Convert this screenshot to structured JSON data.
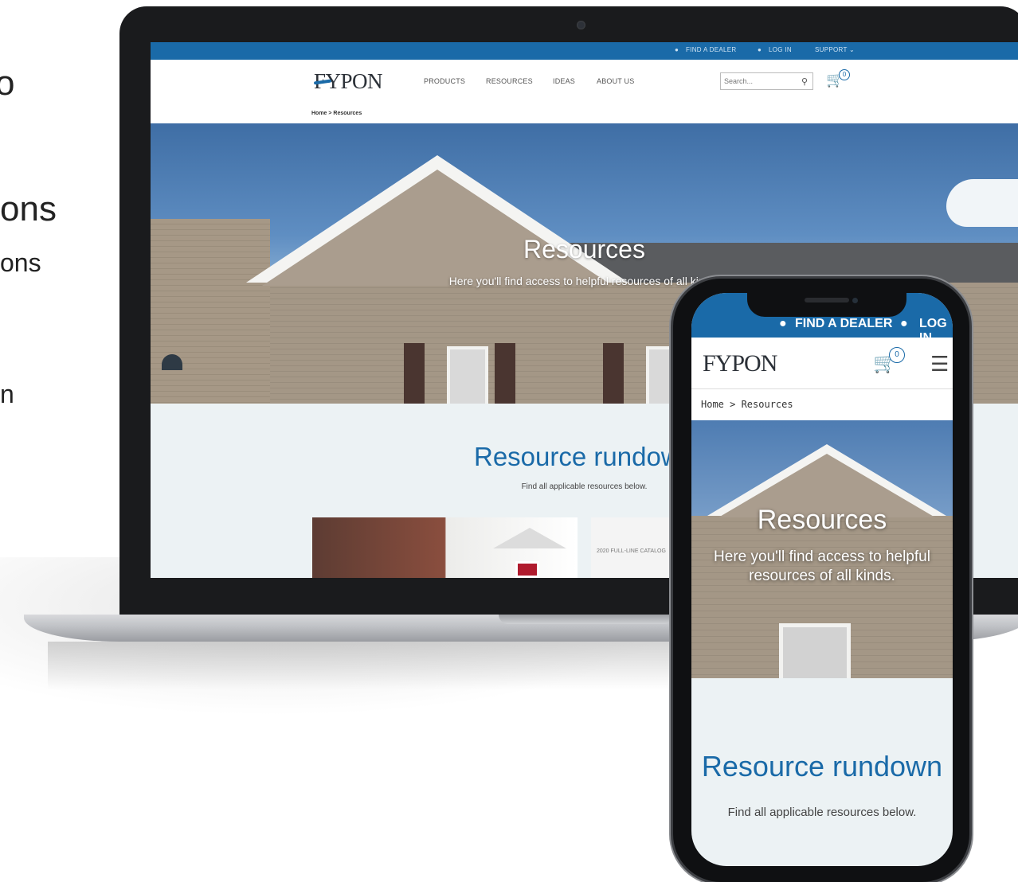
{
  "side_text": [
    "o",
    "ons",
    "ons",
    "n"
  ],
  "desktop": {
    "top_bar": {
      "find_dealer": "FIND A DEALER",
      "log_in": "LOG IN",
      "support": "SUPPORT ⌄"
    },
    "logo": "FYPON",
    "nav": [
      "PRODUCTS",
      "RESOURCES",
      "IDEAS",
      "ABOUT US"
    ],
    "search_placeholder": "Search...",
    "cart_count": "0",
    "breadcrumb": "Home > Resources",
    "hero": {
      "title": "Resources",
      "subtitle": "Here you'll find access to helpful resources of all kinds."
    },
    "content": {
      "title": "Resource rundown",
      "subtitle": "Find all applicable resources below."
    },
    "catalog_label": "2020 FULL-LINE CATALOG"
  },
  "mobile": {
    "top_bar": {
      "find_dealer": "FIND A DEALER",
      "log_in": "LOG IN"
    },
    "logo": "FYPON",
    "cart_count": "0",
    "breadcrumb": "Home > Resources",
    "hero": {
      "title": "Resources",
      "subtitle": "Here you'll find access to helpful resources of all kinds."
    },
    "content": {
      "title": "Resource rundown",
      "subtitle": "Find all applicable resources below."
    }
  },
  "colors": {
    "brand_blue": "#1a6aa8",
    "dark_text": "#2c3138"
  }
}
